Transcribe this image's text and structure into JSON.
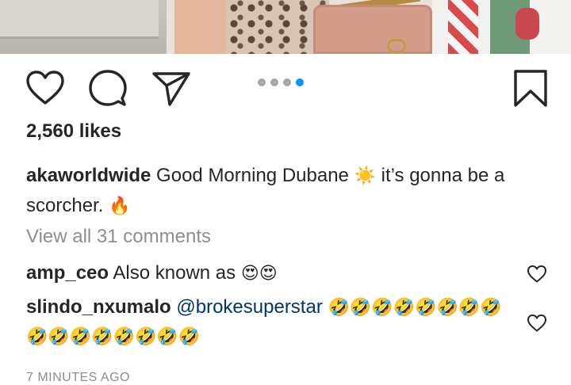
{
  "post": {
    "likes_text": "2,560 likes",
    "caption": {
      "username": "akaworldwide",
      "text_part1": " Good Morning Dubane ",
      "emoji1": "☀️",
      "text_part2": " it’s gonna be a scorcher. ",
      "emoji2": "🔥"
    },
    "view_all_comments": "View all 31 comments",
    "comments": [
      {
        "username": "amp_ceo",
        "text": " Also known as ",
        "emojis": "😍😍"
      },
      {
        "username": "slindo_nxumalo",
        "mention": " @brokesuperstar ",
        "emojis": "🤣🤣🤣🤣🤣🤣🤣🤣🤣🤣🤣🤣🤣🤣🤣🤣"
      }
    ],
    "timestamp": "7 MINUTES AGO"
  },
  "carousel": {
    "count": 4,
    "active_index": 3
  },
  "colors": {
    "text": "#262626",
    "muted": "#8e8e8e",
    "mention": "#00376b",
    "active_dot": "#0095f6",
    "inactive_dot": "#a8a8a8"
  },
  "icons": [
    "heart-icon",
    "comment-icon",
    "share-icon",
    "bookmark-icon",
    "comment-like-heart-icon"
  ]
}
